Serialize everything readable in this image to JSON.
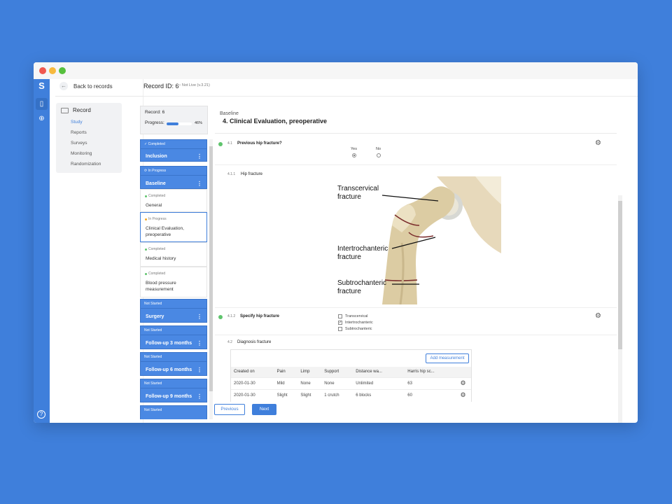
{
  "header": {
    "back_label": "Back to records",
    "record_id": "Record ID: 6",
    "live_status": "○ Not Live (v.3.21)"
  },
  "sidenav": {
    "record_label": "Record",
    "items": [
      "Study",
      "Reports",
      "Surveys",
      "Monitoring",
      "Randomization"
    ],
    "active_item": "Study"
  },
  "status": {
    "record": "Record: 6",
    "progress_label": "Progress:",
    "progress_pct": "46%",
    "progress_value": 0.46
  },
  "steps": {
    "inclusion": {
      "status": "✓ Completed",
      "label": "Inclusion"
    },
    "baseline": {
      "status": "⟳ In Progress",
      "label": "Baseline"
    },
    "baseline_subs": [
      {
        "status": "Completed",
        "label": "General"
      },
      {
        "status": "In Progress",
        "label": "Clinical Evaluation, preoperative"
      },
      {
        "status": "Completed",
        "label": "Medical history"
      },
      {
        "status": "Completed",
        "label": "Blood pressure measurement"
      }
    ],
    "surgery": {
      "status": "Not Started",
      "label": "Surgery"
    },
    "fu3": {
      "status": "Not Started",
      "label": "Follow-up 3 months"
    },
    "fu6": {
      "status": "Not Started",
      "label": "Follow-up 6 months"
    },
    "fu9": {
      "status": "Not Started",
      "label": "Follow-up 9 months"
    },
    "fu12": {
      "status": "Not Started"
    }
  },
  "section": {
    "phase": "Baseline",
    "title": "4. Clinical Evaluation, preoperative"
  },
  "form": {
    "q1": {
      "num": "4.1",
      "text": "Previous hip fracture?",
      "yes": "Yes",
      "no": "No",
      "selected": "Yes"
    },
    "q11": {
      "num": "4.1.1",
      "text": "Hip fracture"
    },
    "image_labels": {
      "transcervical": "Transcervical\nfracture",
      "intertrochanteric": "Intertrochanteric\nfracture",
      "subtrochanteric": "Subtrochanteric\nfracture"
    },
    "q12": {
      "num": "4.1.2",
      "text": "Specify hip fracture",
      "options": [
        {
          "label": "Transcervical",
          "checked": false
        },
        {
          "label": "Intertrochanteric",
          "checked": true
        },
        {
          "label": "Subtrochanteric",
          "checked": false
        }
      ]
    },
    "q2": {
      "num": "4.2",
      "text": "Diagnosis fracture"
    },
    "add_measurement": "Add measurement",
    "table": {
      "columns": [
        "Created on",
        "Pain",
        "Limp",
        "Support",
        "Distance wa...",
        "Harris hip sc..."
      ],
      "rows": [
        [
          "2020-01-30",
          "Mild",
          "None",
          "None",
          "Unlimited",
          "63"
        ],
        [
          "2020-01-30",
          "Slight",
          "Slight",
          "1 crutch",
          "6 blocks",
          "60"
        ]
      ]
    }
  },
  "footer": {
    "previous": "Previous",
    "next": "Next"
  },
  "colors": {
    "brand": "#3f7fdb",
    "completed": "#5fc46d",
    "in_progress": "#f5a623"
  }
}
